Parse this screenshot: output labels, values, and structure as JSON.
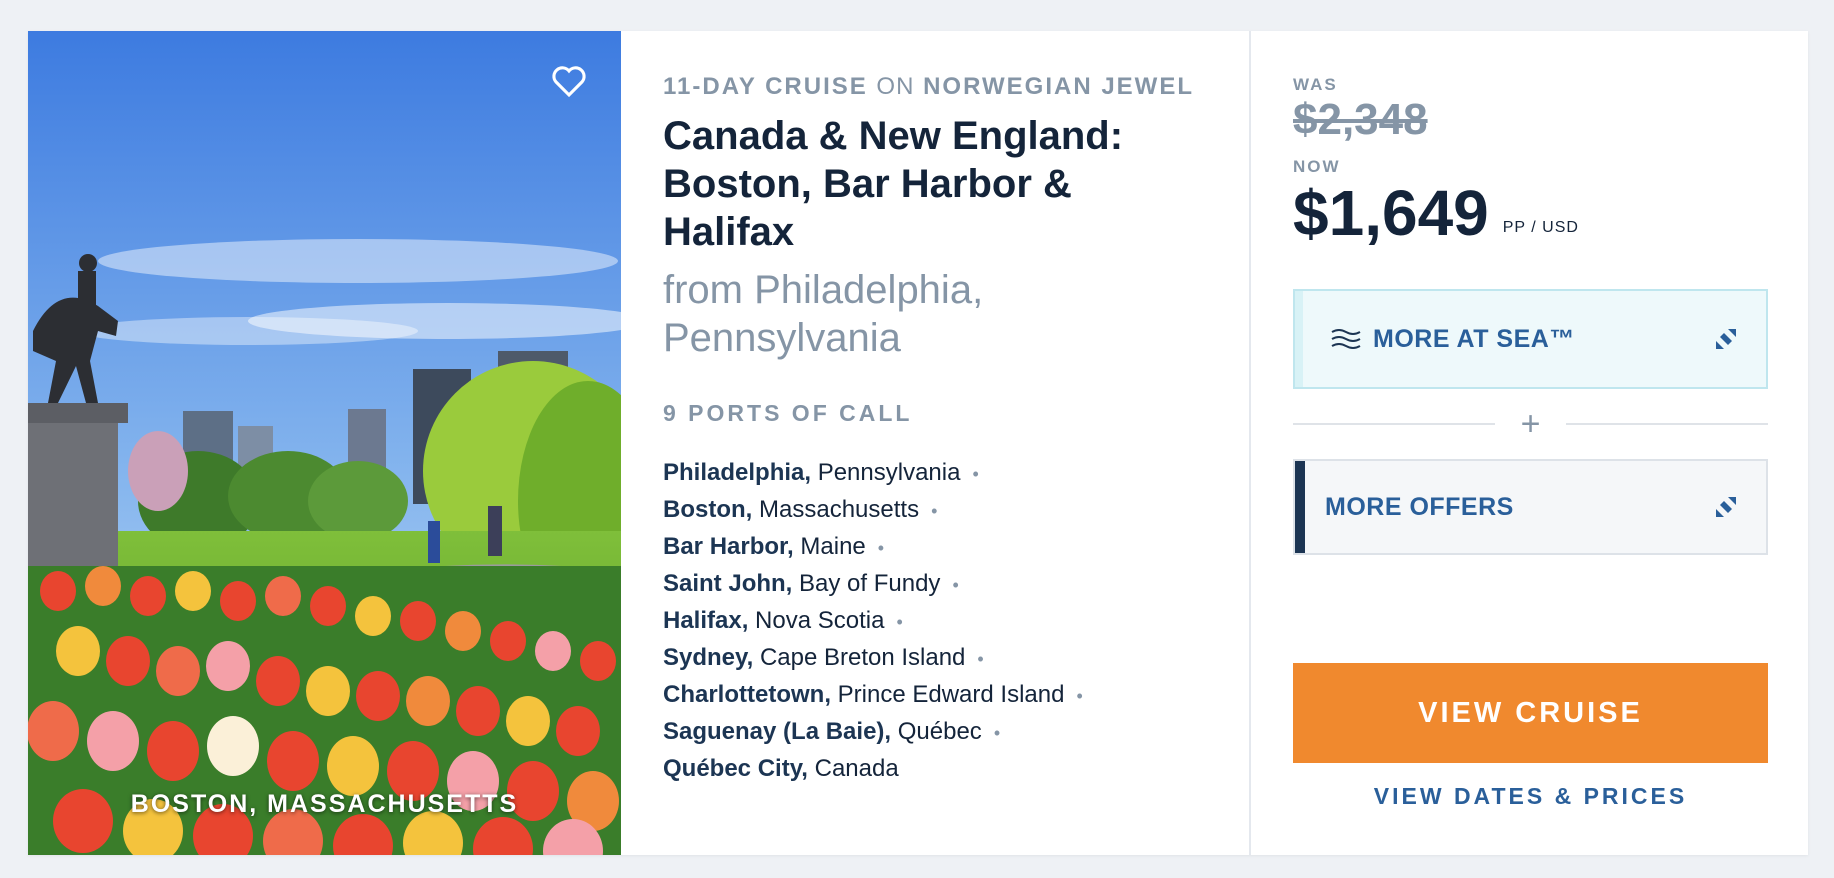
{
  "photo": {
    "caption": "BOSTON, MASSACHUSETTS",
    "favorite_icon": "heart-outline-icon"
  },
  "cruise": {
    "duration": "11-DAY CRUISE",
    "connector": "ON",
    "ship": "NORWEGIAN JEWEL",
    "title": "Canada & New England: Boston, Bar Harbor & Halifax",
    "from": "from Philadelphia, Pennsylvania",
    "ports_heading": "9 PORTS OF CALL",
    "ports": [
      {
        "city": "Philadelphia,",
        "region": "Pennsylvania",
        "dot": "•"
      },
      {
        "city": "Boston,",
        "region": "Massachusetts",
        "dot": "•"
      },
      {
        "city": "Bar Harbor,",
        "region": "Maine",
        "dot": "•"
      },
      {
        "city": "Saint John,",
        "region": "Bay of Fundy",
        "dot": "•"
      },
      {
        "city": "Halifax,",
        "region": "Nova Scotia",
        "dot": "•"
      },
      {
        "city": "Sydney,",
        "region": "Cape Breton Island",
        "dot": "•"
      },
      {
        "city": "Charlottetown,",
        "region": "Prince Edward Island",
        "dot": "•"
      },
      {
        "city": "Saguenay (La Baie),",
        "region": "Québec",
        "dot": "•"
      },
      {
        "city": "Québec City,",
        "region": "Canada",
        "dot": ""
      }
    ]
  },
  "pricing": {
    "was_label": "WAS",
    "was_price": "$2,348",
    "now_label": "NOW",
    "now_price": "$1,649",
    "unit": "PP / USD"
  },
  "offers": {
    "sea_label": "MORE AT SEA™",
    "plus": "+",
    "more_label": "MORE OFFERS"
  },
  "actions": {
    "view_cruise": "VIEW CRUISE",
    "view_dates": "VIEW DATES & PRICES"
  },
  "colors": {
    "cta": "#f0892e",
    "link": "#2a5f9a",
    "navy": "#14243a",
    "muted": "#8595a6"
  }
}
